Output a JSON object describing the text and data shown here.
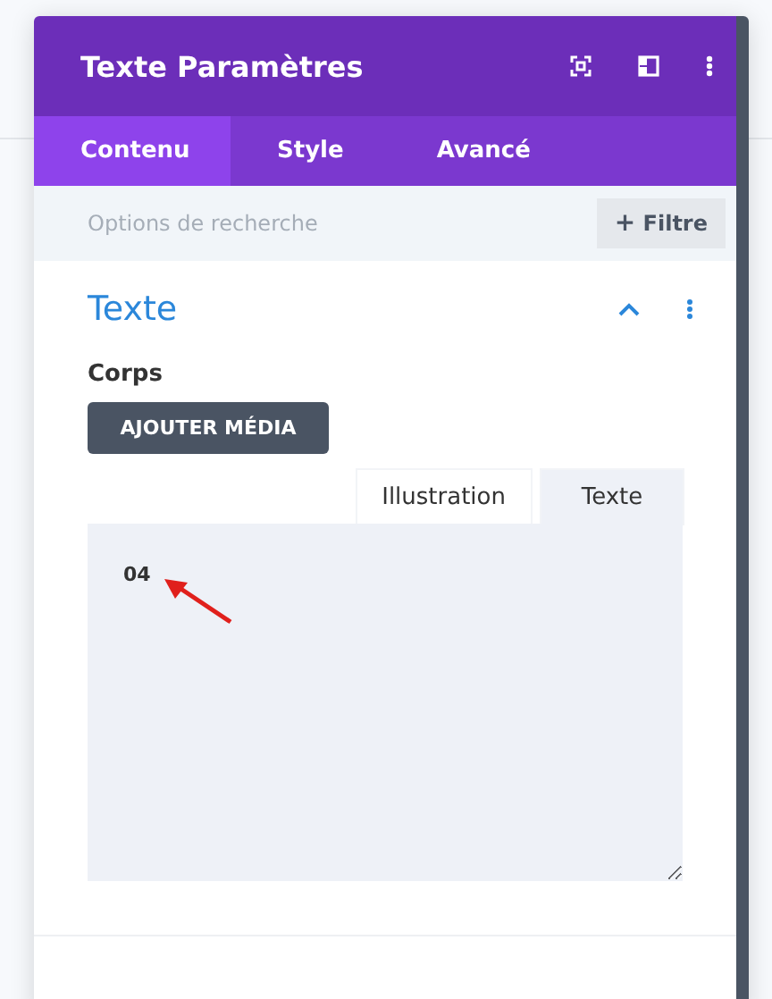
{
  "window": {
    "title": "Texte Paramètres"
  },
  "tabs": [
    {
      "label": "Contenu",
      "selected": true
    },
    {
      "label": "Style",
      "selected": false
    },
    {
      "label": "Avancé",
      "selected": false
    }
  ],
  "search": {
    "placeholder": "Options de recherche"
  },
  "filter_button": {
    "label": "Filtre",
    "icon": "+"
  },
  "section": {
    "title": "Texte",
    "expanded": true,
    "field_label": "Corps",
    "media_button": "AJOUTER MÉDIA",
    "editor_tabs": [
      {
        "label": "Illustration",
        "selected": false
      },
      {
        "label": "Texte",
        "selected": true
      }
    ],
    "editor_value": "04"
  }
}
